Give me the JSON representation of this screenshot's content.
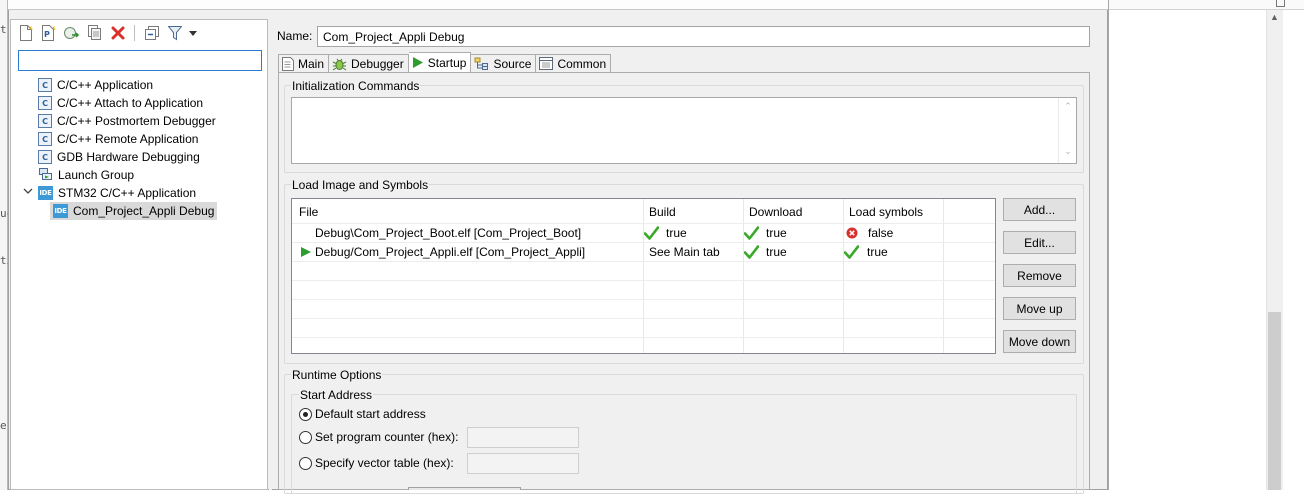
{
  "background": {
    "left_glyphs": [
      "t",
      "uc",
      "ti",
      "er"
    ]
  },
  "toolbar": {
    "buttons": [
      {
        "name": "new-configuration-icon"
      },
      {
        "name": "new-prototype-icon"
      },
      {
        "name": "export-icon"
      },
      {
        "name": "duplicate-icon"
      },
      {
        "name": "delete-icon"
      },
      {
        "name": "collapse-all-icon"
      },
      {
        "name": "filter-icon"
      },
      {
        "name": "dropdown-icon"
      }
    ]
  },
  "filter": {
    "value": "",
    "placeholder": ""
  },
  "tree": {
    "items": [
      {
        "label": "C/C++ Application",
        "icon": "c-icon"
      },
      {
        "label": "C/C++ Attach to Application",
        "icon": "c-icon"
      },
      {
        "label": "C/C++ Postmortem Debugger",
        "icon": "c-icon"
      },
      {
        "label": "C/C++ Remote Application",
        "icon": "c-icon"
      },
      {
        "label": "GDB Hardware Debugging",
        "icon": "c-icon"
      },
      {
        "label": "Launch Group",
        "icon": "launch-group-icon"
      },
      {
        "label": "STM32 C/C++ Application",
        "icon": "ide-icon",
        "icon_text": "IDE",
        "expanded": true
      },
      {
        "label": "Com_Project_Appli Debug",
        "icon": "ide-icon",
        "icon_text": "IDE",
        "selected": true
      }
    ]
  },
  "name": {
    "label": "Name:",
    "value": "Com_Project_Appli Debug"
  },
  "tabs": [
    {
      "label": "Main",
      "icon": "main-tab-icon"
    },
    {
      "label": "Debugger",
      "icon": "debugger-tab-icon"
    },
    {
      "label": "Startup",
      "icon": "startup-tab-icon",
      "active": true
    },
    {
      "label": "Source",
      "icon": "source-tab-icon"
    },
    {
      "label": "Common",
      "icon": "common-tab-icon"
    }
  ],
  "init_commands": {
    "title": "Initialization Commands",
    "value": ""
  },
  "load_image": {
    "title": "Load Image and Symbols",
    "columns": [
      "File",
      "Build",
      "Download",
      "Load symbols"
    ],
    "rows": [
      {
        "file": "Debug\\Com_Project_Boot.elf [Com_Project_Boot]",
        "file_icon": "",
        "build": "true",
        "build_icon": "check-icon",
        "download": "true",
        "download_icon": "check-icon",
        "symbols": "false",
        "symbols_icon": "error-icon"
      },
      {
        "file": "Debug/Com_Project_Appli.elf [Com_Project_Appli]",
        "file_icon": "run-arrow-icon",
        "build": "See Main tab",
        "build_icon": "",
        "download": "true",
        "download_icon": "check-icon",
        "symbols": "true",
        "symbols_icon": "check-icon"
      }
    ],
    "buttons": {
      "add": "Add...",
      "edit": "Edit...",
      "remove": "Remove",
      "move_up": "Move up",
      "move_down": "Move down"
    }
  },
  "runtime": {
    "title": "Runtime Options",
    "start_address": {
      "title": "Start Address",
      "options": [
        {
          "label": "Default start address",
          "checked": true
        },
        {
          "label": "Set program counter (hex):",
          "checked": false
        },
        {
          "label": "Specify vector table (hex):",
          "checked": false
        }
      ]
    }
  },
  "colors": {
    "accent": "#2b7bd0",
    "check": "#3aa829",
    "error": "#d9302c",
    "run": "#2e9c2e",
    "ide": "#3e9ad6"
  }
}
